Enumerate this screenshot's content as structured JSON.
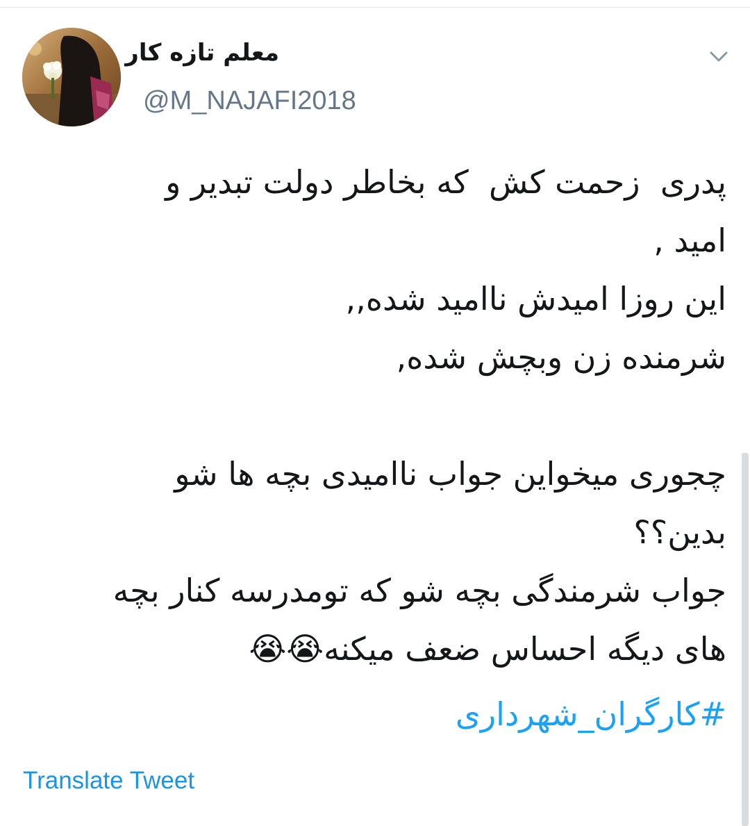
{
  "tweet": {
    "author": {
      "display_name": "معلم تازه کار",
      "handle": "@M_NAJAFI2018"
    },
    "body_lines": [
      "پدری  زحمت کش  که بخاطر دولت تبدیر و",
      "امید ,",
      "این روزا امیدش ناامید شده,,",
      "شرمنده زن وبچش شده,",
      "",
      "چجوری میخواین جواب ناامیدی بچه ها شو",
      "بدین؟؟",
      "جواب شرمندگی بچه شو که تومدرسه کنار بچه",
      "های دیگه احساس ضعف میکنه😭😭"
    ],
    "hashtag": "#کارگران_شهرداری",
    "translate_label": "Translate Tweet"
  },
  "colors": {
    "text": "#14171a",
    "secondary": "#657786",
    "link": "#1da1f2",
    "translate_link": "#1b95e0"
  },
  "icons": {
    "menu": "chevron-down-icon",
    "emoji": "loudly-crying-face"
  }
}
